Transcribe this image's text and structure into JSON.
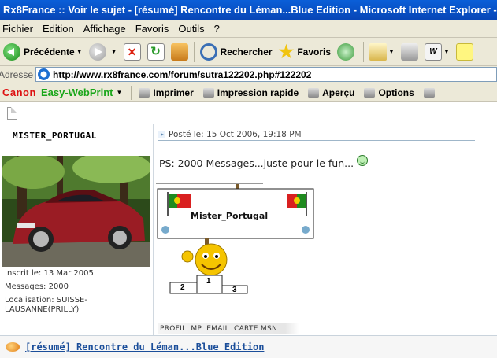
{
  "window": {
    "title": "Rx8France :: Voir le sujet - [résumé] Rencontre du Léman...Blue Edition - Microsoft Internet Explorer - "
  },
  "menu": [
    "Fichier",
    "Edition",
    "Affichage",
    "Favoris",
    "Outils",
    "?"
  ],
  "toolbar": {
    "back_label": "Précédente",
    "search_label": "Rechercher",
    "favorites_label": "Favoris"
  },
  "address": {
    "label": "Adresse",
    "url": "http://www.rx8france.com/forum/sutra122202.php#122202"
  },
  "canon_bar": {
    "brand": "Canon",
    "product": "Easy-WebPrint",
    "print_label": "Imprimer",
    "quick_print_label": "Impression rapide",
    "preview_label": "Aperçu",
    "options_label": "Options"
  },
  "post": {
    "username": "MISTER_PORTUGAL",
    "joined": "Inscrit le: 13 Mar 2005",
    "messages": "Messages: 2000",
    "location_line1": "Localisation: SUISSE-",
    "location_line2": "LAUSANNE(PRILLY)",
    "posted": "Posté le: 15 Oct 2006, 19:18 PM",
    "body": "PS: 2000 Messages...juste pour le fun...",
    "sign_text": "Mister_Portugal",
    "podium": [
      "2",
      "1",
      "3"
    ],
    "profile_links": [
      "PROFIL",
      "MP",
      "EMAIL",
      "CARTE MSN"
    ]
  },
  "footer": {
    "link": "[résumé] Rencontre du Léman...Blue Edition"
  },
  "colors": {
    "title_bar": "#0a5fd8",
    "chrome": "#ece9d8",
    "link": "#1b4e9a",
    "canon_red": "#d11111",
    "ewp_green": "#1aa61a"
  }
}
